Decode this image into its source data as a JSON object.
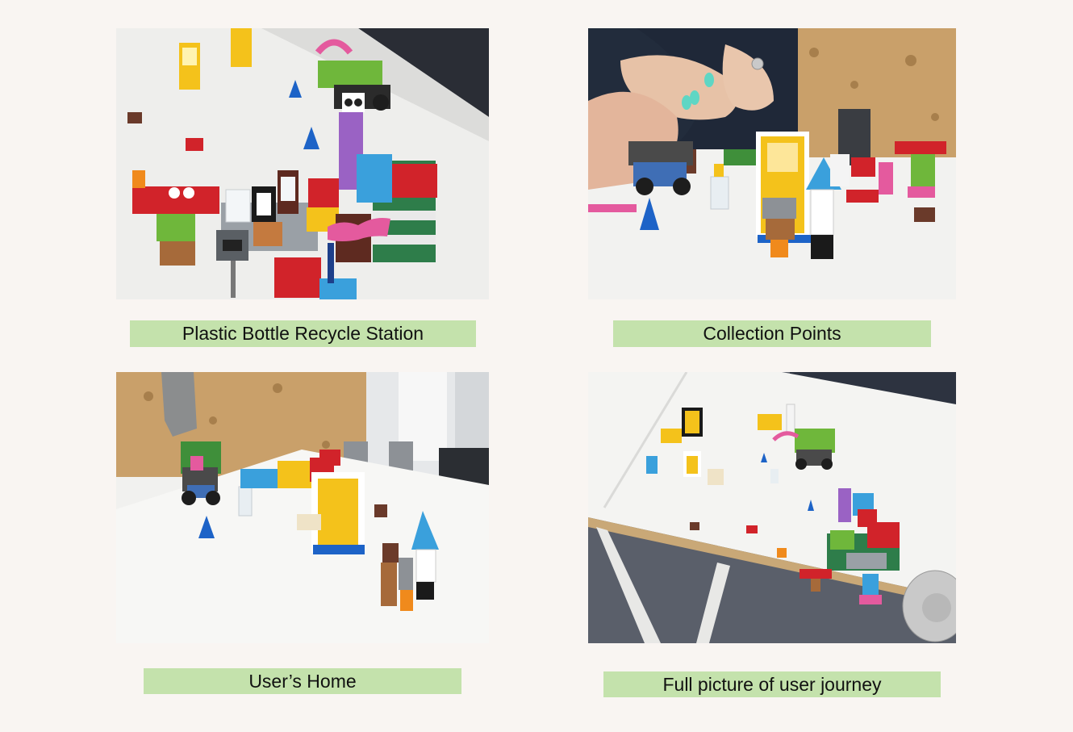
{
  "photos": [
    {
      "caption": "Plastic Bottle Recycle Station",
      "subject": "lego-recycle-station-photo"
    },
    {
      "caption": "Collection Points",
      "subject": "lego-collection-points-photo"
    },
    {
      "caption": "User’s Home",
      "subject": "lego-users-home-photo"
    },
    {
      "caption": "Full picture of user journey",
      "subject": "lego-user-journey-overview-photo"
    }
  ],
  "colors": {
    "background": "#f9f5f2",
    "caption_bg": "#c4e2ac",
    "table_white": "#f2f2f0",
    "cork_wall": "#c9a06a",
    "brick_red": "#d1232a",
    "brick_blue": "#1d63c7",
    "brick_yellow": "#f4c21b",
    "brick_green": "#6fb73b",
    "brick_pink": "#e45a9e"
  }
}
